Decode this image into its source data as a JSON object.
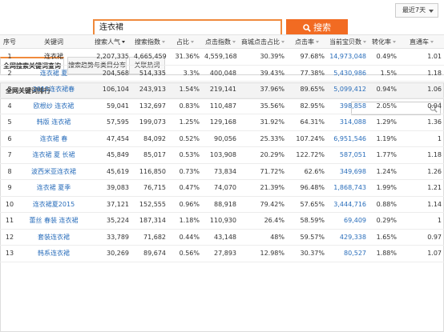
{
  "top": {
    "range_label": "最近7天",
    "search_value": "连衣裙",
    "search_button": "搜索"
  },
  "tabs": [
    {
      "label": "全网搜索关键词查询",
      "active": true
    },
    {
      "label": "搜索趋势与类目分布",
      "active": false
    },
    {
      "label": "关联热词",
      "active": false
    }
  ],
  "panel": {
    "title": "全网关键词排行",
    "filter_placeholder": ""
  },
  "table": {
    "headers": [
      "序号",
      "关键词",
      "搜索人气",
      "搜索指数",
      "占比",
      "点击指数",
      "商城点击占比",
      "点击率",
      "当前宝贝数",
      "转化率",
      "直通车"
    ],
    "sorted_column": 2,
    "rows": [
      {
        "n": "1",
        "kw": "连衣裙",
        "kw_link": false,
        "pop": "2,207,335",
        "idx": "4,665,459",
        "share": "31.36%",
        "click": "4,559,168",
        "mall": "30.39%",
        "ctr": "97.68%",
        "items": "14,973,048",
        "items_link": true,
        "cvr": "0.49%",
        "ztc": "1.01"
      },
      {
        "n": "2",
        "kw": "连衣裙 夏",
        "kw_link": true,
        "pop": "204,568",
        "idx": "514,335",
        "share": "3.3%",
        "click": "400,048",
        "mall": "39.43%",
        "ctr": "77.38%",
        "items": "5,430,986",
        "items_link": true,
        "cvr": "1.5%",
        "ztc": "1.18"
      },
      {
        "n": "3",
        "kw": "2015连衣裙春",
        "kw_link": true,
        "pop": "106,104",
        "idx": "243,913",
        "share": "1.54%",
        "click": "219,141",
        "mall": "37.96%",
        "ctr": "89.65%",
        "items": "5,099,412",
        "items_link": true,
        "cvr": "0.94%",
        "ztc": "1.06"
      },
      {
        "n": "4",
        "kw": "欧根纱 连衣裙",
        "kw_link": true,
        "pop": "59,041",
        "idx": "132,697",
        "share": "0.83%",
        "click": "110,487",
        "mall": "35.56%",
        "ctr": "82.95%",
        "items": "398,858",
        "items_link": true,
        "cvr": "2.05%",
        "ztc": "0.94"
      },
      {
        "n": "5",
        "kw": "韩版 连衣裙",
        "kw_link": true,
        "pop": "57,595",
        "idx": "199,073",
        "share": "1.25%",
        "click": "129,168",
        "mall": "31.92%",
        "ctr": "64.31%",
        "items": "314,088",
        "items_link": true,
        "cvr": "1.29%",
        "ztc": "1.36"
      },
      {
        "n": "6",
        "kw": "连衣裙 春",
        "kw_link": true,
        "pop": "47,454",
        "idx": "84,092",
        "share": "0.52%",
        "click": "90,056",
        "mall": "25.33%",
        "ctr": "107.24%",
        "items": "6,951,546",
        "items_link": true,
        "cvr": "1.19%",
        "ztc": "1"
      },
      {
        "n": "7",
        "kw": "连衣裙 夏 长裙",
        "kw_link": true,
        "pop": "45,849",
        "idx": "85,017",
        "share": "0.53%",
        "click": "103,908",
        "mall": "20.29%",
        "ctr": "122.72%",
        "items": "587,051",
        "items_link": true,
        "cvr": "1.77%",
        "ztc": "1.18"
      },
      {
        "n": "8",
        "kw": "波西米亚连衣裙",
        "kw_link": true,
        "pop": "45,619",
        "idx": "116,850",
        "share": "0.73%",
        "click": "73,834",
        "mall": "71.72%",
        "ctr": "62.6%",
        "items": "349,698",
        "items_link": true,
        "cvr": "1.24%",
        "ztc": "1.26"
      },
      {
        "n": "9",
        "kw": "连衣裙 夏季",
        "kw_link": true,
        "pop": "39,083",
        "idx": "76,715",
        "share": "0.47%",
        "click": "74,070",
        "mall": "21.39%",
        "ctr": "96.48%",
        "items": "1,868,743",
        "items_link": true,
        "cvr": "1.99%",
        "ztc": "1.21"
      },
      {
        "n": "10",
        "kw": "连衣裙夏2015",
        "kw_link": true,
        "pop": "37,121",
        "idx": "152,555",
        "share": "0.96%",
        "click": "88,918",
        "mall": "79.42%",
        "ctr": "57.65%",
        "items": "3,444,716",
        "items_link": true,
        "cvr": "0.88%",
        "ztc": "1.14"
      },
      {
        "n": "11",
        "kw": "蕾丝 春装 连衣裙",
        "kw_link": true,
        "pop": "35,224",
        "idx": "187,314",
        "share": "1.18%",
        "click": "110,930",
        "mall": "26.4%",
        "ctr": "58.59%",
        "items": "69,409",
        "items_link": true,
        "cvr": "0.29%",
        "ztc": "1"
      },
      {
        "n": "12",
        "kw": "套装连衣裙",
        "kw_link": true,
        "pop": "33,789",
        "idx": "71,682",
        "share": "0.44%",
        "click": "43,148",
        "mall": "48%",
        "ctr": "59.57%",
        "items": "429,338",
        "items_link": true,
        "cvr": "1.65%",
        "ztc": "0.97"
      },
      {
        "n": "13",
        "kw": "韩系连衣裙",
        "kw_link": true,
        "pop": "30,269",
        "idx": "89,674",
        "share": "0.56%",
        "click": "27,893",
        "mall": "12.98%",
        "ctr": "30.37%",
        "items": "80,527",
        "items_link": true,
        "cvr": "1.88%",
        "ztc": "1.07"
      }
    ]
  }
}
